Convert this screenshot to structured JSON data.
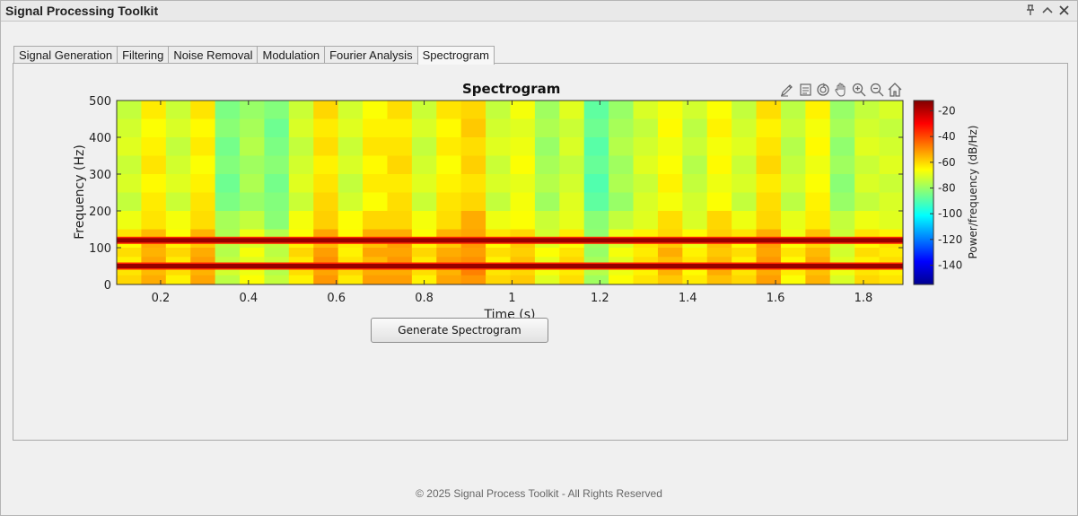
{
  "window": {
    "title": "Signal Processing Toolkit",
    "controls": [
      "pin-icon",
      "collapse-icon",
      "close-icon"
    ]
  },
  "tabs": [
    {
      "label": "Signal Generation",
      "active": false
    },
    {
      "label": "Filtering",
      "active": false
    },
    {
      "label": "Noise Removal",
      "active": false
    },
    {
      "label": "Modulation",
      "active": false
    },
    {
      "label": "Fourier Analysis",
      "active": false
    },
    {
      "label": "Spectrogram",
      "active": true
    }
  ],
  "axes_toolbar": [
    "brush-icon",
    "datatip-icon",
    "rotate-icon",
    "pan-icon",
    "zoom-in-icon",
    "zoom-out-icon",
    "home-icon"
  ],
  "generate_button_label": "Generate Spectrogram",
  "footer_text": "© 2025 Signal Process Toolkit - All Rights Reserved",
  "chart_data": {
    "type": "heatmap",
    "title": "Spectrogram",
    "xlabel": "Time (s)",
    "ylabel": "Frequency (Hz)",
    "colorbar_label": "Power/frequency (dB/Hz)",
    "xlim": [
      0.1,
      1.89
    ],
    "ylim": [
      0,
      500
    ],
    "xticks": [
      0.2,
      0.4,
      0.6,
      0.8,
      1,
      1.2,
      1.4,
      1.6,
      1.8
    ],
    "yticks": [
      0,
      100,
      200,
      300,
      400,
      500
    ],
    "clim": [
      -155,
      -12
    ],
    "colorbar_ticks": [
      -20,
      -40,
      -60,
      -80,
      -100,
      -120,
      -140
    ],
    "colormap": "jet",
    "tone_frequencies_hz": [
      50,
      120
    ],
    "tone_power_db": -15,
    "frequency_rows_hz": [
      475,
      425,
      375,
      325,
      275,
      225,
      175,
      135,
      110,
      87,
      65,
      37,
      12
    ],
    "time_columns_s": [
      0.128,
      0.184,
      0.24,
      0.296,
      0.352,
      0.408,
      0.464,
      0.52,
      0.576,
      0.632,
      0.688,
      0.744,
      0.8,
      0.856,
      0.912,
      0.968,
      1.024,
      1.08,
      1.136,
      1.192,
      1.248,
      1.304,
      1.36,
      1.416,
      1.472,
      1.528,
      1.584,
      1.64,
      1.696,
      1.752,
      1.808,
      1.864
    ],
    "time_column_power_db": [
      -72,
      -64,
      -72,
      -64,
      -84,
      -78,
      -84,
      -72,
      -62,
      -72,
      -64,
      -62,
      -72,
      -64,
      -60,
      -72,
      -68,
      -78,
      -72,
      -88,
      -78,
      -72,
      -66,
      -74,
      -66,
      -72,
      -62,
      -74,
      -66,
      -80,
      -72,
      -72
    ]
  }
}
